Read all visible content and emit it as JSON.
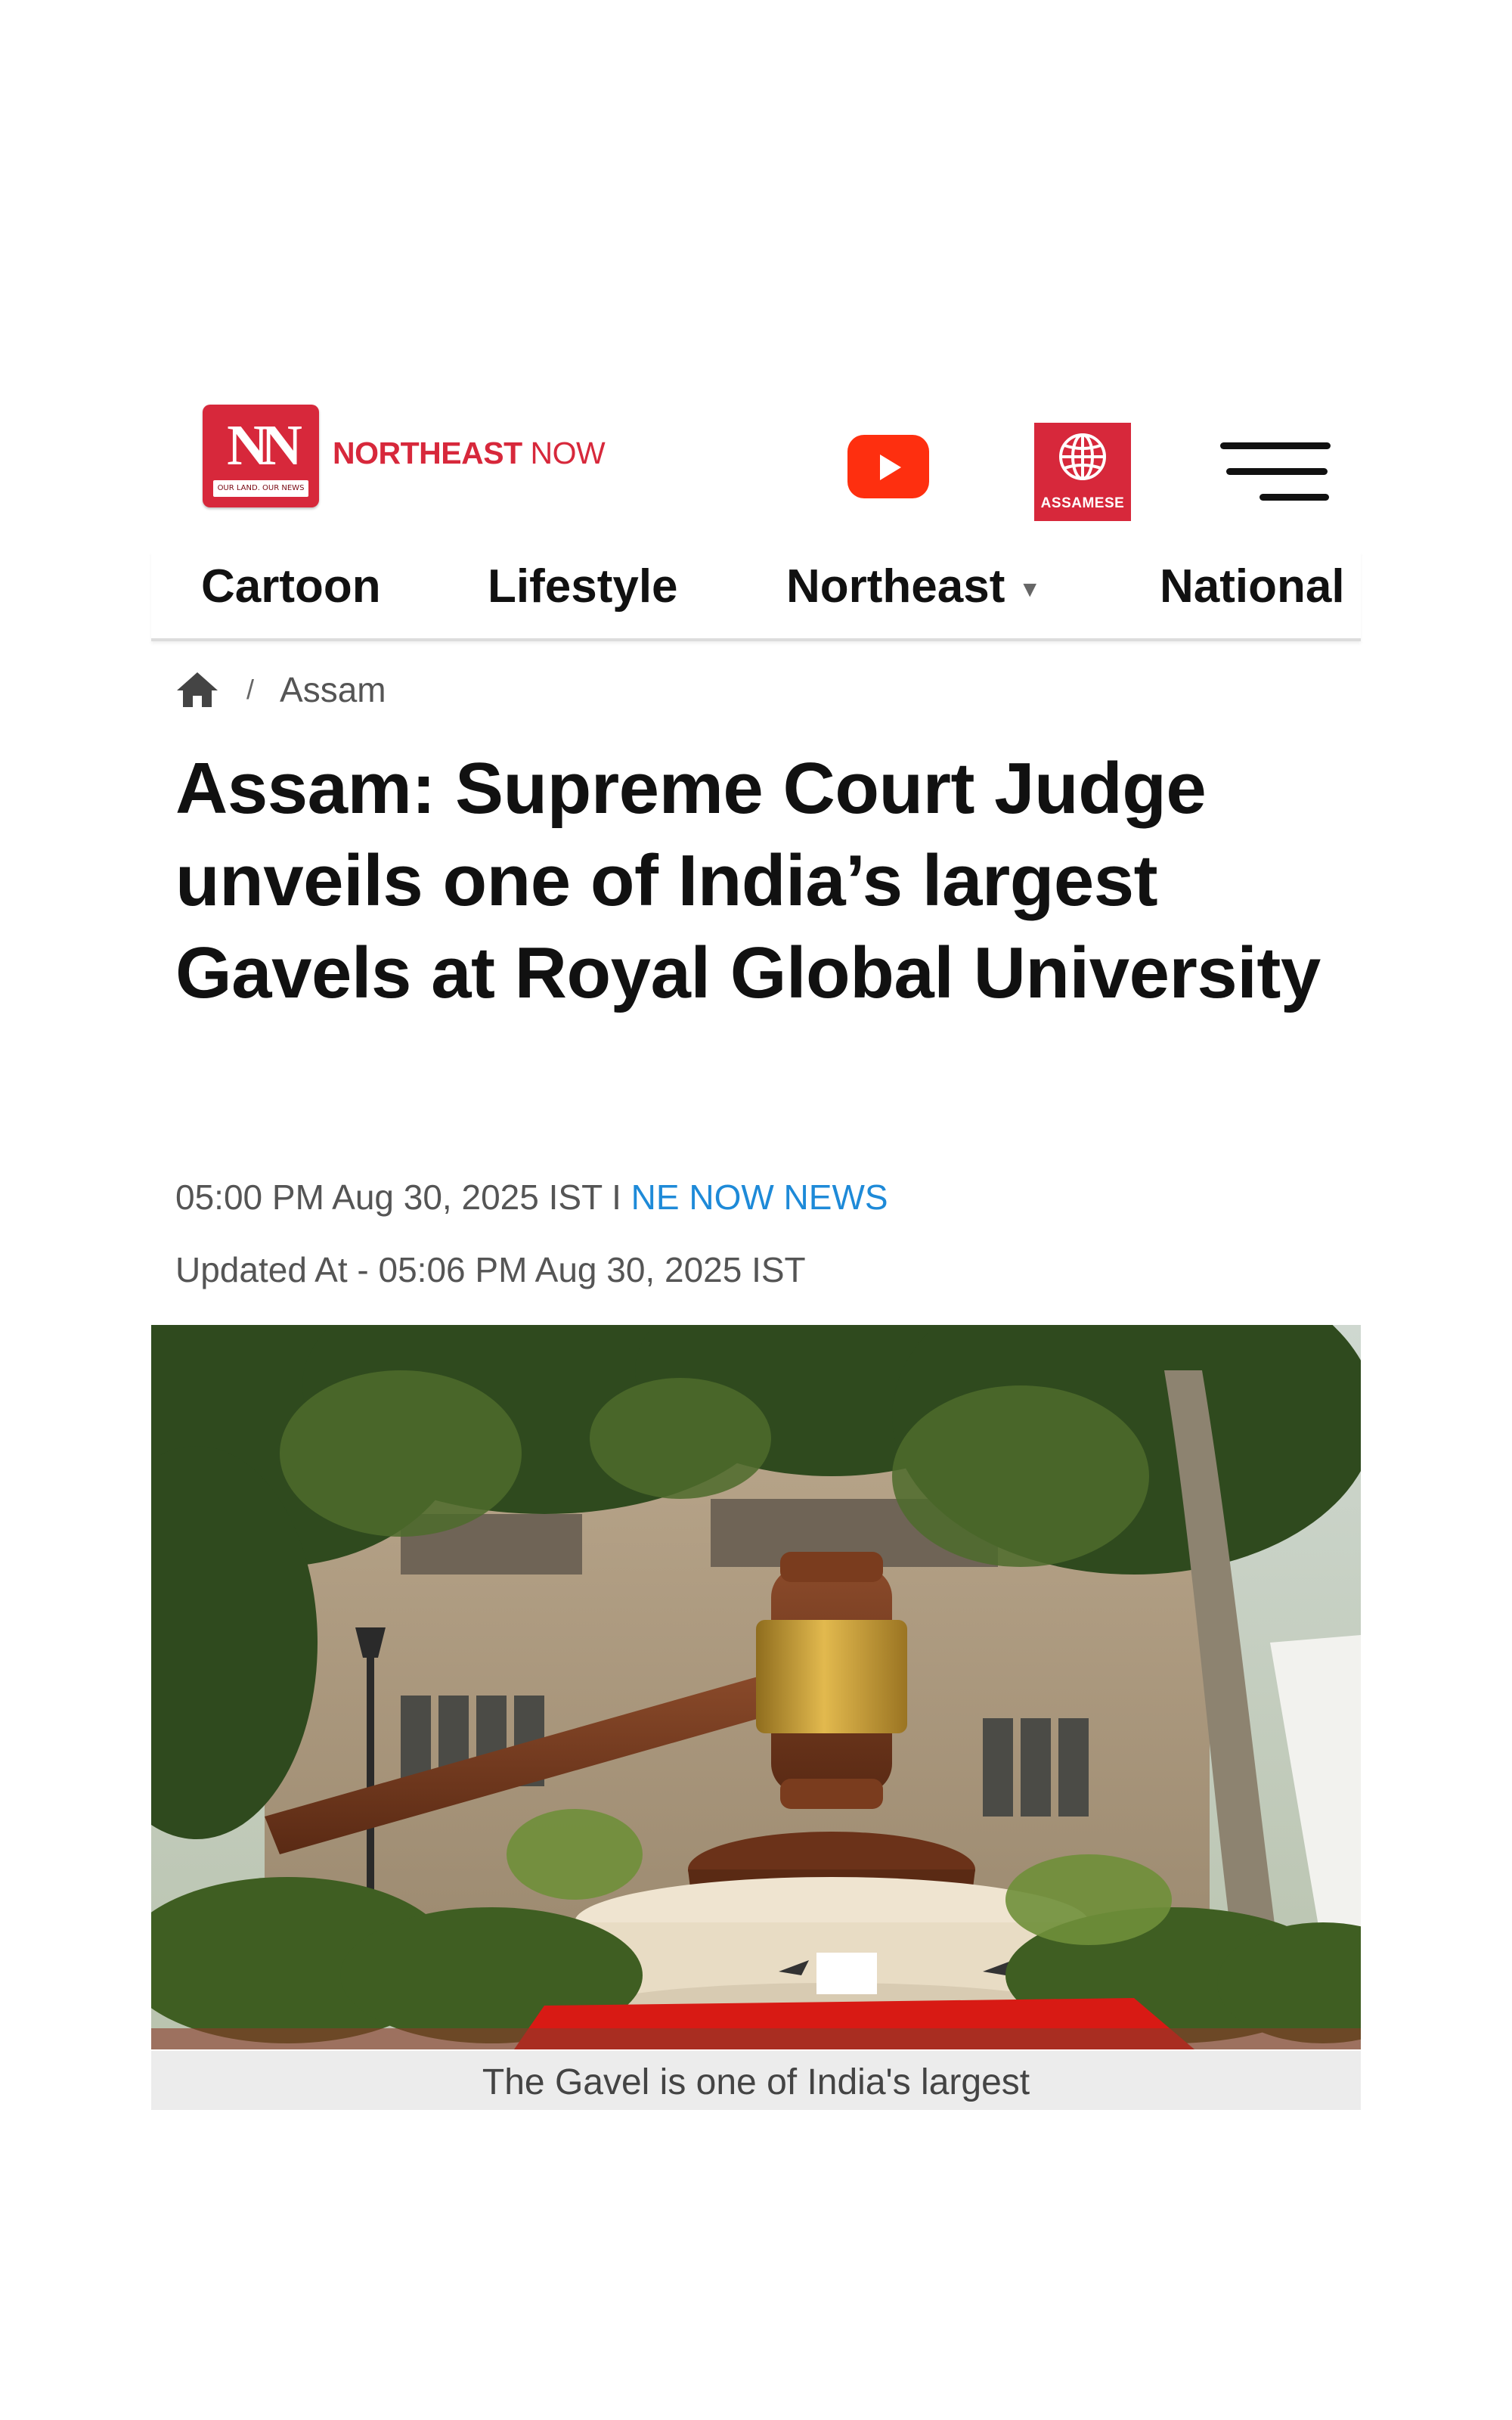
{
  "header": {
    "logo": {
      "monogram": "NN",
      "tagline": "OUR LAND. OUR NEWS",
      "brand_bold": "NORTHEAST",
      "brand_light": " NOW"
    },
    "youtube_icon": "youtube-play-icon",
    "assamese_label": "ASSAMESE",
    "assamese_icon": "globe-icon",
    "menu_icon": "hamburger-menu-icon",
    "brand_color": "#d7283b"
  },
  "nav": {
    "items": [
      {
        "label": "Cartoon"
      },
      {
        "label": "Lifestyle"
      },
      {
        "label": "Northeast",
        "dropdown": true
      },
      {
        "label": "National"
      }
    ],
    "caret": "▼"
  },
  "breadcrumb": {
    "home_icon": "home-icon",
    "separator": "/",
    "section": "Assam"
  },
  "article": {
    "title": "Assam: Supreme Court Judge unveils one of India’s largest Gavels at Royal Global University",
    "published": "05:00 PM Aug 30, 2025 IST I ",
    "author": "NE NOW NEWS",
    "updated": "Updated At - 05:06 PM Aug 30, 2025 IST",
    "image_caption": "The Gavel is one of India's largest",
    "author_color": "#1e8ad8"
  }
}
